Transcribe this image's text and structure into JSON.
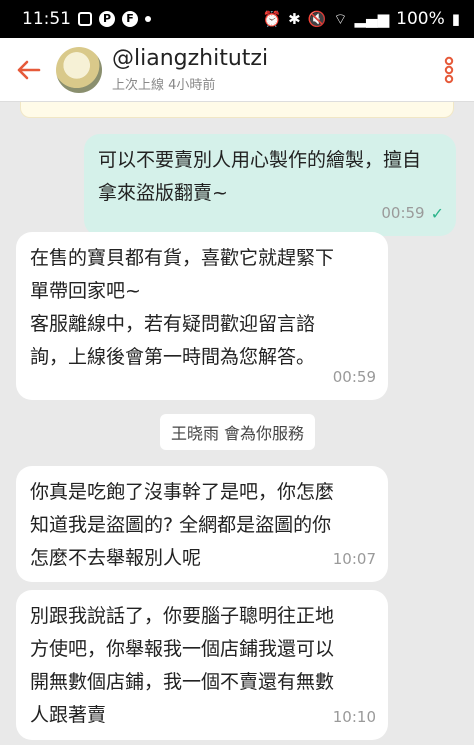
{
  "status_bar": {
    "time": "11:51",
    "battery": "100%"
  },
  "header": {
    "back_icon": "back-arrow-icon",
    "username": "@liangzhitutzi",
    "last_seen": "上次上線 4小時前",
    "menu_icon": "kebab-menu-icon",
    "accent_color": "#e65a3a"
  },
  "messages": [
    {
      "direction": "out",
      "text": "可以不要賣別人用心製作的繪製，擅自拿來盜版翻賣~",
      "time": "00:59",
      "status_icon": "sent-check-icon"
    },
    {
      "direction": "in",
      "lines": [
        "在售的寶貝都有貨，喜歡它就趕緊下",
        "單帶回家吧~",
        "客服離線中，若有疑問歡迎留言諮",
        "詢，上線後會第一時間為您解答。"
      ],
      "time": "00:59"
    },
    {
      "direction": "system",
      "text": "王晓雨 會為你服務"
    },
    {
      "direction": "in",
      "lines": [
        "你真是吃飽了沒事幹了是吧，你怎麼",
        "知道我是盜圖的? 全網都是盜圖的你",
        "怎麼不去舉報別人呢"
      ],
      "time": "10:07"
    },
    {
      "direction": "in",
      "lines": [
        "別跟我說話了，你要腦子聰明往正地",
        "方使吧，你舉報我一個店鋪我還可以",
        "開無數個店鋪，我一個不賣還有無數",
        "人跟著賣"
      ],
      "time": "10:10"
    }
  ]
}
